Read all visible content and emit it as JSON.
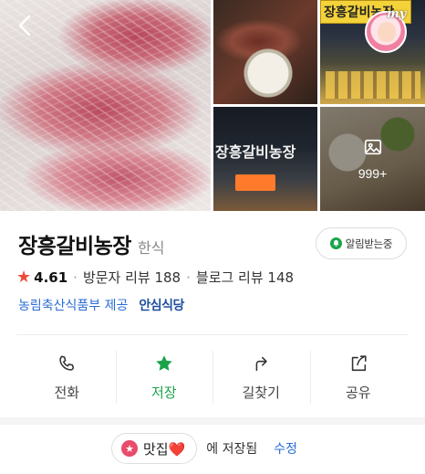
{
  "gallery": {
    "photo_count_label": "999+",
    "night_sign_text": "장흥갈비농장",
    "dark_sign_text": "장흥갈비농장",
    "badge_text": "my"
  },
  "place": {
    "name": "장흥갈비농장",
    "category": "한식",
    "notify_label": "알림받는중"
  },
  "rating": {
    "score": "4.61",
    "visitor_reviews": "방문자 리뷰 188",
    "blog_reviews": "블로그 리뷰 148"
  },
  "provider": {
    "link_text": "농림축산식품부 제공",
    "cert_mark": "안심식당"
  },
  "actions": [
    {
      "label": "전화",
      "icon": "phone-icon"
    },
    {
      "label": "저장",
      "icon": "star-icon",
      "active": true
    },
    {
      "label": "길찾기",
      "icon": "directions-icon"
    },
    {
      "label": "공유",
      "icon": "share-icon"
    }
  ],
  "saved": {
    "folder_name": "맛집❤️",
    "suffix": "에 저장됨",
    "edit_label": "수정"
  },
  "colors": {
    "accent_green": "#1aa34a",
    "link_blue": "#2a6bd6",
    "star_red": "#ef4b3a",
    "folder_pink": "#e94b6a"
  }
}
